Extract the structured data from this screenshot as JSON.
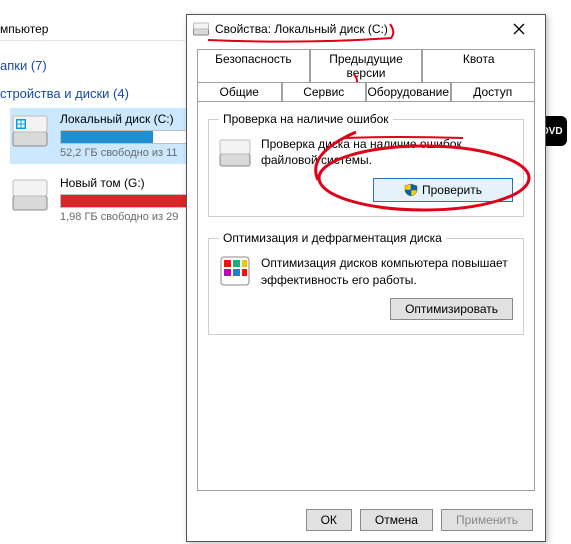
{
  "explorer": {
    "title_fragment": "мпьютер",
    "section_folders": "апки (7)",
    "section_drives": "стройства и диски (4)",
    "drives": [
      {
        "name": "Локальный диск (C:)",
        "free": "52,2 ГБ свободно из 11",
        "fill_pct": 55,
        "fill_color": "#1e90d2"
      },
      {
        "name": "Новый том (G:)",
        "free": "1,98 ГБ свободно из 29",
        "fill_pct": 92,
        "fill_color": "#d9262a"
      }
    ],
    "dvd_label": "DVD"
  },
  "dialog": {
    "title": "Свойства: Локальный диск (C:)",
    "tabs_row1": [
      "Безопасность",
      "Предыдущие версии",
      "Квота"
    ],
    "tabs_row2": [
      "Общие",
      "Сервис",
      "Оборудование",
      "Доступ"
    ],
    "active_tab": "Сервис",
    "group_check": {
      "legend": "Проверка на наличие ошибок",
      "text": "Проверка диска на наличие ошибок файловой системы.",
      "button": "Проверить"
    },
    "group_defrag": {
      "legend": "Оптимизация и дефрагментация диска",
      "text": "Оптимизация дисков компьютера повышает эффективность его работы.",
      "button": "Оптимизировать"
    },
    "buttons": {
      "ok": "ОК",
      "cancel": "Отмена",
      "apply": "Применить"
    }
  }
}
